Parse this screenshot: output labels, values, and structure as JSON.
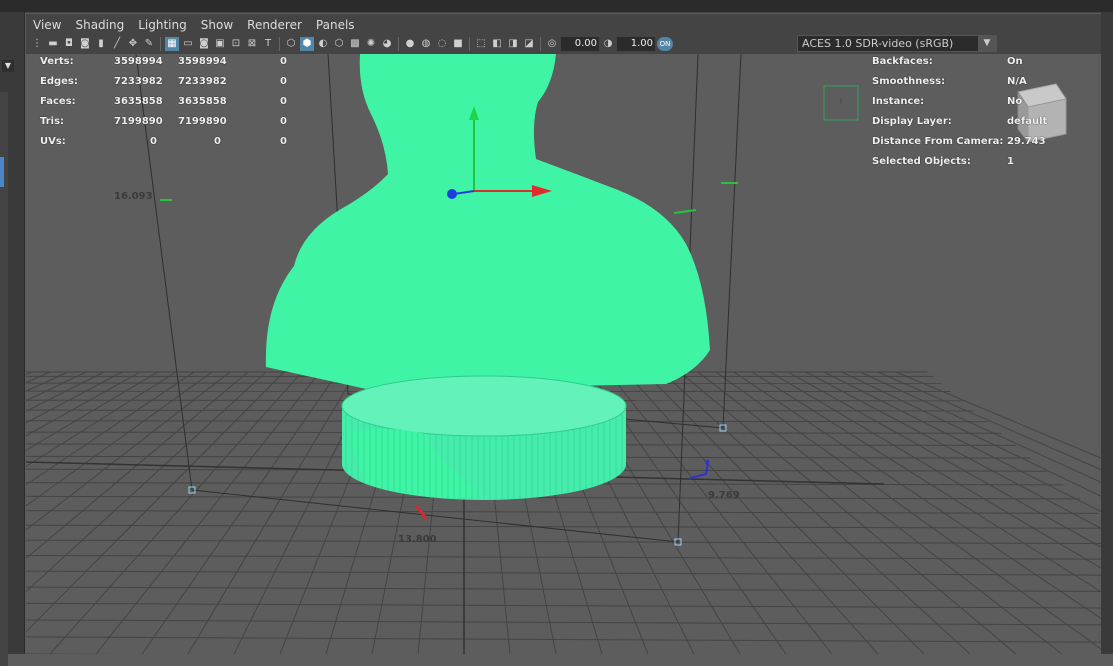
{
  "menu": [
    "View",
    "Shading",
    "Lighting",
    "Show",
    "Renderer",
    "Panels"
  ],
  "toolbar": {
    "exposure": "0.00",
    "gamma": "1.00",
    "on_label": "ON",
    "color_space": "ACES 1.0 SDR-video (sRGB)"
  },
  "hud_left": {
    "rows": [
      {
        "label": "Verts:",
        "a": "3598994",
        "b": "3598994",
        "c": "0"
      },
      {
        "label": "Edges:",
        "a": "7233982",
        "b": "7233982",
        "c": "0"
      },
      {
        "label": "Faces:",
        "a": "3635858",
        "b": "3635858",
        "c": "0"
      },
      {
        "label": "Tris:",
        "a": "7199890",
        "b": "7199890",
        "c": "0"
      },
      {
        "label": "UVs:",
        "a": "0",
        "b": "0",
        "c": "0"
      }
    ]
  },
  "hud_right": {
    "rows": [
      {
        "label": "Backfaces:",
        "value": "On"
      },
      {
        "label": "Smoothness:",
        "value": "N/A"
      },
      {
        "label": "Instance:",
        "value": "No"
      },
      {
        "label": "Display Layer:",
        "value": "default"
      },
      {
        "label": "Distance From Camera:",
        "value": "29.743"
      },
      {
        "label": "Selected Objects:",
        "value": "1"
      }
    ]
  },
  "measurements": {
    "left": "16.093",
    "bottom": "13.800",
    "right": "9.769"
  },
  "colors": {
    "model": "#3ff5a5",
    "grid": "#4a4a4a",
    "viewport_bg": "#5d5d5d",
    "accent": "#5285a6"
  }
}
